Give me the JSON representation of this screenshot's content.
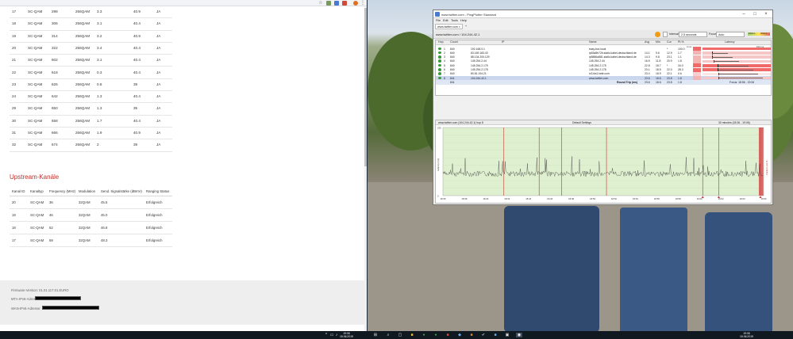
{
  "downstream": {
    "rows": [
      [
        "17",
        "SC-QAM",
        "298",
        "256QAM",
        "3.3",
        "40.9",
        "JA"
      ],
      [
        "18",
        "SC-QAM",
        "306",
        "256QAM",
        "3.1",
        "40.4",
        "JA"
      ],
      [
        "19",
        "SC-QAM",
        "314",
        "256QAM",
        "3.2",
        "40.9",
        "JA"
      ],
      [
        "20",
        "SC-QAM",
        "322",
        "256QAM",
        "3.4",
        "40.4",
        "JA"
      ],
      [
        "21",
        "SC-QAM",
        "602",
        "256QAM",
        "3.1",
        "40.4",
        "JA"
      ],
      [
        "22",
        "SC-QAM",
        "618",
        "256QAM",
        "0.3",
        "40.4",
        "JA"
      ],
      [
        "23",
        "SC-QAM",
        "626",
        "256QAM",
        "0.8",
        "39",
        "JA"
      ],
      [
        "24",
        "SC-QAM",
        "642",
        "256QAM",
        "1.3",
        "40.4",
        "JA"
      ],
      [
        "29",
        "SC-QAM",
        "650",
        "256QAM",
        "1.3",
        "35",
        "JA"
      ],
      [
        "30",
        "SC-QAM",
        "658",
        "256QAM",
        "1.7",
        "40.4",
        "JA"
      ],
      [
        "31",
        "SC-QAM",
        "666",
        "256QAM",
        "1.9",
        "40.9",
        "JA"
      ],
      [
        "32",
        "SC-QAM",
        "674",
        "256QAM",
        "2",
        "39",
        "JA"
      ]
    ]
  },
  "upstream": {
    "title": "Upstream-Kanäle",
    "headers": [
      "Kanal ID",
      "Kanaltyp",
      "Frequency (MHz)",
      "Modulation",
      "Send. Signalstärke (dBmV)",
      "Ranging Status"
    ],
    "rows": [
      [
        "20",
        "SC-QAM",
        "36",
        "32QAM",
        "45.5",
        "Erfolgreich"
      ],
      [
        "19",
        "SC-QAM",
        "46",
        "32QAM",
        "45.0",
        "Erfolgreich"
      ],
      [
        "18",
        "SC-QAM",
        "52",
        "32QAM",
        "46.8",
        "Erfolgreich"
      ],
      [
        "17",
        "SC-QAM",
        "59",
        "32QAM",
        "48.3",
        "Erfolgreich"
      ]
    ]
  },
  "footer": {
    "firmware": "Firmware-Version: 01.01.117.01.EURO",
    "mta": "MTA-IPv6-Adresse:",
    "wan": "WAN-IPv6-Adresse:"
  },
  "pingplotter": {
    "window_title": "www.twitter.com - PingPlotter Standard",
    "menu": [
      "File",
      "Edit",
      "Tools",
      "Help"
    ],
    "tab": "www.twitter.com",
    "target": "www.twitter.com / 104.244.42.1",
    "interval_label": "Interval",
    "interval_value": "2.5 seconds",
    "focus_label": "Focus",
    "focus_value": "Auto",
    "legend_left": "100ms",
    "legend_right": "200ms",
    "columns": [
      "Hop",
      "Count",
      "IP",
      "Name",
      "Avg",
      "Min",
      "Cur",
      "PL%",
      "Latency"
    ],
    "latency_axis": [
      "0 ms",
      "100 ms"
    ],
    "hops": [
      {
        "hop": "1",
        "count": "840",
        "ip": "192.168.0.1",
        "name": "easy.box.local",
        "avg": "",
        "min": "",
        "cur": "*",
        "pl": "100.0",
        "plcolor": "#f06a6a"
      },
      {
        "hop": "2",
        "count": "840",
        "ip": "83.169.183.43",
        "name": "ip53a8b72b.static.kabel-deutschland.de",
        "avg": "14.1",
        "min": "9.6",
        "cur": "12.9",
        "pl": "1.7",
        "plcolor": "#f3b4b4"
      },
      {
        "hop": "3",
        "count": "840",
        "ip": "88.134.200.129",
        "name": "ip5886a881.static.kabel-deutschland.de",
        "avg": "14.3",
        "min": "9.8",
        "cur": "23.1",
        "pl": "1.1",
        "plcolor": "#f3b4b4"
      },
      {
        "hop": "4",
        "count": "840",
        "ip": "145.254.2.44",
        "name": "145.254.2.44",
        "avg": "16.5",
        "min": "11.8",
        "cur": "20.9",
        "pl": "1.8",
        "plcolor": "#f3b4b4"
      },
      {
        "hop": "5",
        "count": "840",
        "ip": "145.254.2.175",
        "name": "145.254.2.175",
        "avg": "22.8",
        "min": "18.7",
        "cur": "*",
        "pl": "34.0",
        "plcolor": "#f06a6a"
      },
      {
        "hop": "6",
        "count": "840",
        "ip": "145.254.2.178",
        "name": "145.254.2.178",
        "avg": "23.1",
        "min": "18.5",
        "cur": "22.0",
        "pl": "28.3",
        "plcolor": "#f06a6a"
      },
      {
        "hop": "7",
        "count": "840",
        "ip": "80.81.194.21",
        "name": "ix3-fra1.twttr.com",
        "avg": "23.4",
        "min": "18.9",
        "cur": "22.1",
        "pl": "0.6",
        "plcolor": "#f6d0d0"
      },
      {
        "hop": "8",
        "count": "841",
        "ip": "104.244.42.1",
        "name": "www.twitter.com",
        "avg": "23.6",
        "min": "18.6",
        "cur": "23.8",
        "pl": "1.8",
        "plcolor": "#f3b4b4"
      }
    ],
    "round_trip": {
      "count": "841",
      "label": "Round Trip (ms)",
      "avg": "23.6",
      "min": "18.6",
      "cur": "23.8",
      "pl": "1.8",
      "focus": "Focus: 18:56 - 19:06"
    },
    "chart_head_left": "www.twitter.com (104.244.42.1) hop 8",
    "chart_head_mid": "Default Settings",
    "chart_head_right": "30 minutes (18:36 - 19:06)",
    "chart_y_label": "Latency (ms)",
    "chart_y2_label": "Packet Loss %",
    "chart_y_ticks": [
      "235",
      "",
      "",
      "",
      "",
      "",
      "",
      "",
      "",
      "0"
    ],
    "chart_x_ticks": [
      "18:36",
      "18:38",
      "18:40",
      "18:42",
      "18:44",
      "18:46",
      "18:48",
      "18:50",
      "18:52",
      "18:54",
      "18:56",
      "18:58",
      "19:00",
      "19:02",
      "19:04",
      "19:06"
    ]
  },
  "taskbar": {
    "clock_time": "19:06",
    "clock_date": "15.06.2019",
    "clock2_time": "19:06",
    "clock2_date": "15.06.2019"
  },
  "colors": {
    "accent_red": "#c0302b",
    "chart_bg": "#dff0d0",
    "chart_line": "#333333",
    "loss_mark": "#c0302b"
  }
}
